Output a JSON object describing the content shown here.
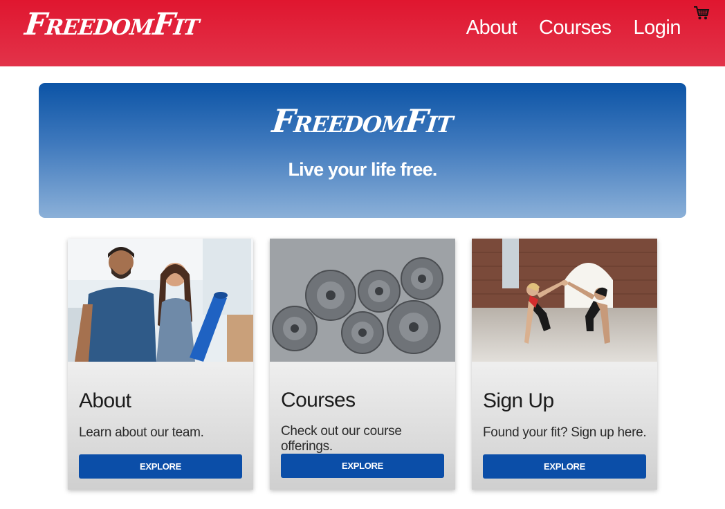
{
  "navbar": {
    "brand": "FreedomFit",
    "links": [
      "About",
      "Courses",
      "Login"
    ],
    "cart_icon": "shopping-cart-icon"
  },
  "hero": {
    "title": "FreedomFit",
    "tagline": "Live your life free."
  },
  "cards": [
    {
      "title": "About",
      "text": "Learn about our team.",
      "button": "EXPLORE",
      "image": "couple-with-yoga-mat-photo"
    },
    {
      "title": "Courses",
      "text": "Check out our course offerings.",
      "button": "EXPLORE",
      "image": "weight-plates-photo"
    },
    {
      "title": "Sign Up",
      "text": "Found your fit? Sign up here.",
      "button": "EXPLORE",
      "image": "women-high-five-plank-photo"
    }
  ],
  "colors": {
    "navbar_red": "#e0162f",
    "hero_blue": "#0c54a6",
    "button_blue": "#0b4ea8"
  }
}
